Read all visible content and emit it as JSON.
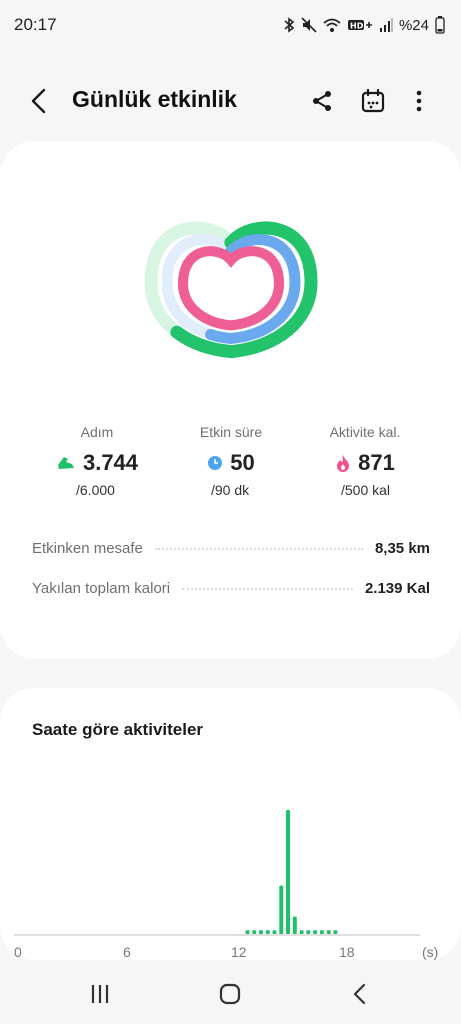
{
  "status": {
    "time": "20:17",
    "battery": "%24"
  },
  "header": {
    "title": "Günlük etkinlik"
  },
  "stats": [
    {
      "label": "Adım",
      "value": "3.744",
      "goal": "/6.000",
      "icon": "shoe-icon",
      "color": "#1fc068"
    },
    {
      "label": "Etkin süre",
      "value": "50",
      "goal": "/90 dk",
      "icon": "clock-icon",
      "color": "#4aa3ef"
    },
    {
      "label": "Aktivite kal.",
      "value": "871",
      "goal": "/500 kal",
      "icon": "flame-icon",
      "color": "#f0508e"
    }
  ],
  "rings": [
    {
      "name": "steps",
      "progress": 0.624,
      "color": "#22c36b",
      "track": "#d8f5e4"
    },
    {
      "name": "active-time",
      "progress": 0.556,
      "color": "#6aa9ee",
      "track": "#e1edfb"
    },
    {
      "name": "calories",
      "progress": 1.0,
      "color": "#ef5f95",
      "track": "#fbe0ea"
    }
  ],
  "details": [
    {
      "label": "Etkinken mesafe",
      "value": "8,35 km"
    },
    {
      "label": "Yakılan toplam kalori",
      "value": "2.139 Kal"
    }
  ],
  "hourly": {
    "title": "Saate göre aktiviteler",
    "axis_unit": "(s)",
    "ticks": [
      "0",
      "6",
      "12",
      "18"
    ]
  },
  "chart_data": {
    "type": "bar",
    "xlabel": "(s)",
    "xlim": [
      0,
      24
    ],
    "tick_labels": [
      "0",
      "6",
      "12",
      "18"
    ],
    "bars": [
      {
        "x": 13.8,
        "value": 0.03
      },
      {
        "x": 14.2,
        "value": 0.03
      },
      {
        "x": 14.6,
        "value": 0.03
      },
      {
        "x": 15.0,
        "value": 0.03
      },
      {
        "x": 15.4,
        "value": 0.03
      },
      {
        "x": 15.8,
        "value": 0.39
      },
      {
        "x": 16.2,
        "value": 1.0
      },
      {
        "x": 16.6,
        "value": 0.14
      },
      {
        "x": 17.0,
        "value": 0.03
      },
      {
        "x": 17.4,
        "value": 0.03
      },
      {
        "x": 17.8,
        "value": 0.03
      },
      {
        "x": 18.2,
        "value": 0.03
      },
      {
        "x": 18.6,
        "value": 0.03
      },
      {
        "x": 19.0,
        "value": 0.03
      }
    ]
  }
}
